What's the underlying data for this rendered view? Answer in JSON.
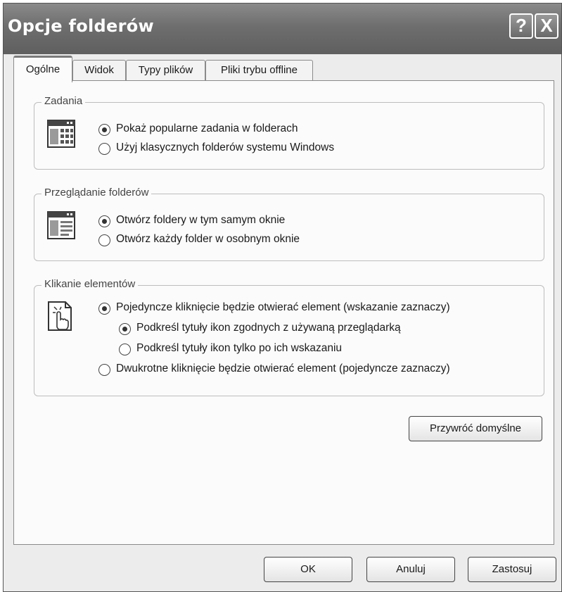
{
  "window": {
    "title": "Opcje folderów",
    "help_label": "?",
    "close_label": "X"
  },
  "tabs": [
    {
      "label": "Ogólne",
      "active": true
    },
    {
      "label": "Widok",
      "active": false
    },
    {
      "label": "Typy plików",
      "active": false
    },
    {
      "label": "Pliki trybu offline",
      "active": false
    }
  ],
  "tasks_group": {
    "legend": "Zadania",
    "icon": "window-tasks-icon",
    "options": [
      {
        "label": "Pokaż popularne zadania w folderach",
        "selected": true
      },
      {
        "label": "Użyj klasycznych folderów systemu Windows",
        "selected": false
      }
    ]
  },
  "browse_group": {
    "legend": "Przeglądanie folderów",
    "icon": "window-browse-icon",
    "options": [
      {
        "label": "Otwórz foldery w tym samym oknie",
        "selected": true
      },
      {
        "label": "Otwórz każdy folder w osobnym oknie",
        "selected": false
      }
    ]
  },
  "click_group": {
    "legend": "Klikanie elementów",
    "icon": "hand-pointer-icon",
    "options": [
      {
        "label": "Pojedyncze kliknięcie będzie otwierać element (wskazanie zaznaczy)",
        "selected": true
      },
      {
        "label": "Podkreśl tytuły ikon zgodnych z używaną przeglądarką",
        "selected": true
      },
      {
        "label": "Podkreśl tytuły ikon tylko po ich wskazaniu",
        "selected": false
      },
      {
        "label": "Dwukrotne kliknięcie będzie otwierać element (pojedyncze zaznaczy)",
        "selected": false
      }
    ]
  },
  "restore_defaults_label": "Przywróć domyślne",
  "buttons": {
    "ok": "OK",
    "cancel": "Anuluj",
    "apply": "Zastosuj"
  }
}
